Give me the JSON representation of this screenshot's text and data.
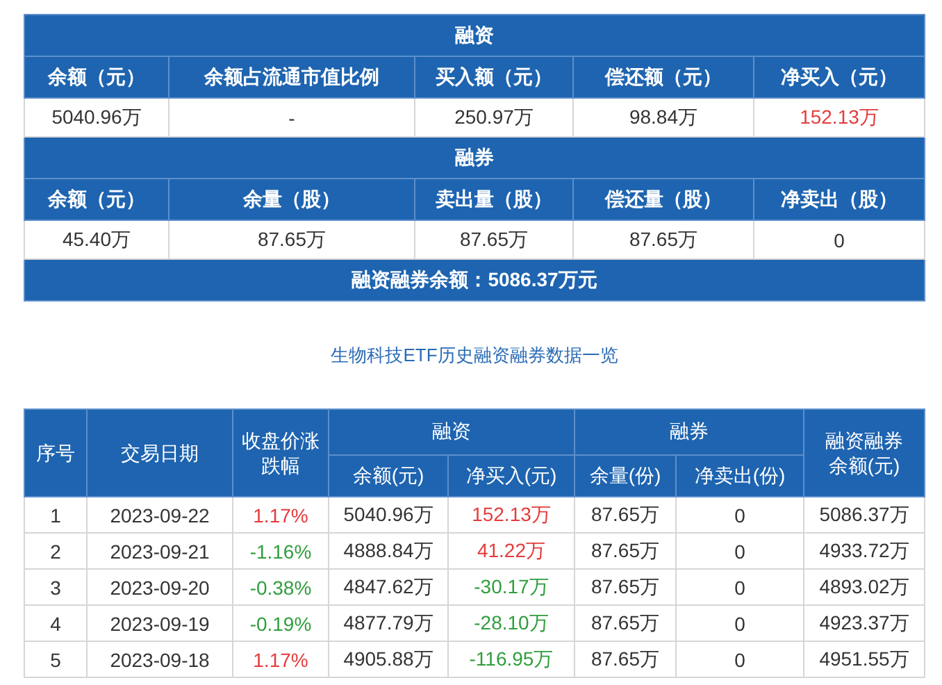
{
  "summary": {
    "margin_title": "融资",
    "margin_columns": [
      "余额（元）",
      "余额占流通市值比例",
      "买入额（元）",
      "偿还额（元）",
      "净买入（元）"
    ],
    "margin_values": [
      {
        "text": "5040.96万"
      },
      {
        "text": "-"
      },
      {
        "text": "250.97万"
      },
      {
        "text": "98.84万"
      },
      {
        "text": "152.13万",
        "color": "#e43b3b"
      }
    ],
    "short_title": "融券",
    "short_columns": [
      "余额（元）",
      "余量（股）",
      "卖出量（股）",
      "偿还量（股）",
      "净卖出（股）"
    ],
    "short_values": [
      {
        "text": "45.40万"
      },
      {
        "text": "87.65万"
      },
      {
        "text": "87.65万"
      },
      {
        "text": "87.65万"
      },
      {
        "text": "0"
      }
    ],
    "total": "融资融券余额：5086.37万元"
  },
  "history_title": "生物科技ETF历史融资融券数据一览",
  "history": {
    "header_groups": [
      {
        "label": "序号"
      },
      {
        "label": "交易日期"
      },
      {
        "label": "收盘价涨跌幅"
      },
      {
        "label": "融资",
        "children": [
          "余额(元)",
          "净买入(元)"
        ]
      },
      {
        "label": "融券",
        "children": [
          "余量(份)",
          "净卖出(份)"
        ]
      },
      {
        "label": "融资融券余额(元)"
      }
    ],
    "rows": [
      {
        "index": "1",
        "date": "2023-09-22",
        "change": {
          "text": "1.17%",
          "color": "#e43b3b"
        },
        "balance": "5040.96万",
        "net_buy": {
          "text": "152.13万",
          "color": "#e43b3b"
        },
        "short_qty": "87.65万",
        "net_sell": "0",
        "total": "5086.37万"
      },
      {
        "index": "2",
        "date": "2023-09-21",
        "change": {
          "text": "-1.16%",
          "color": "#2f9e3c"
        },
        "balance": "4888.84万",
        "net_buy": {
          "text": "41.22万",
          "color": "#e43b3b"
        },
        "short_qty": "87.65万",
        "net_sell": "0",
        "total": "4933.72万"
      },
      {
        "index": "3",
        "date": "2023-09-20",
        "change": {
          "text": "-0.38%",
          "color": "#2f9e3c"
        },
        "balance": "4847.62万",
        "net_buy": {
          "text": "-30.17万",
          "color": "#2f9e3c"
        },
        "short_qty": "87.65万",
        "net_sell": "0",
        "total": "4893.02万"
      },
      {
        "index": "4",
        "date": "2023-09-19",
        "change": {
          "text": "-0.19%",
          "color": "#2f9e3c"
        },
        "balance": "4877.79万",
        "net_buy": {
          "text": "-28.10万",
          "color": "#2f9e3c"
        },
        "short_qty": "87.65万",
        "net_sell": "0",
        "total": "4923.37万"
      },
      {
        "index": "5",
        "date": "2023-09-18",
        "change": {
          "text": "1.17%",
          "color": "#e43b3b"
        },
        "balance": "4905.88万",
        "net_buy": {
          "text": "-116.95万",
          "color": "#2f9e3c"
        },
        "short_qty": "87.65万",
        "net_sell": "0",
        "total": "4951.55万"
      }
    ]
  }
}
